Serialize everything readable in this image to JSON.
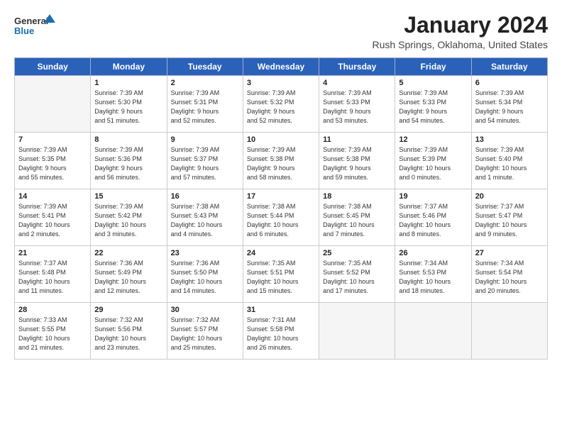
{
  "logo": {
    "line1": "General",
    "line2": "Blue"
  },
  "title": "January 2024",
  "location": "Rush Springs, Oklahoma, United States",
  "days_header": [
    "Sunday",
    "Monday",
    "Tuesday",
    "Wednesday",
    "Thursday",
    "Friday",
    "Saturday"
  ],
  "weeks": [
    [
      {
        "day": "",
        "info": ""
      },
      {
        "day": "1",
        "info": "Sunrise: 7:39 AM\nSunset: 5:30 PM\nDaylight: 9 hours\nand 51 minutes."
      },
      {
        "day": "2",
        "info": "Sunrise: 7:39 AM\nSunset: 5:31 PM\nDaylight: 9 hours\nand 52 minutes."
      },
      {
        "day": "3",
        "info": "Sunrise: 7:39 AM\nSunset: 5:32 PM\nDaylight: 9 hours\nand 52 minutes."
      },
      {
        "day": "4",
        "info": "Sunrise: 7:39 AM\nSunset: 5:33 PM\nDaylight: 9 hours\nand 53 minutes."
      },
      {
        "day": "5",
        "info": "Sunrise: 7:39 AM\nSunset: 5:33 PM\nDaylight: 9 hours\nand 54 minutes."
      },
      {
        "day": "6",
        "info": "Sunrise: 7:39 AM\nSunset: 5:34 PM\nDaylight: 9 hours\nand 54 minutes."
      }
    ],
    [
      {
        "day": "7",
        "info": "Sunrise: 7:39 AM\nSunset: 5:35 PM\nDaylight: 9 hours\nand 55 minutes."
      },
      {
        "day": "8",
        "info": "Sunrise: 7:39 AM\nSunset: 5:36 PM\nDaylight: 9 hours\nand 56 minutes."
      },
      {
        "day": "9",
        "info": "Sunrise: 7:39 AM\nSunset: 5:37 PM\nDaylight: 9 hours\nand 57 minutes."
      },
      {
        "day": "10",
        "info": "Sunrise: 7:39 AM\nSunset: 5:38 PM\nDaylight: 9 hours\nand 58 minutes."
      },
      {
        "day": "11",
        "info": "Sunrise: 7:39 AM\nSunset: 5:38 PM\nDaylight: 9 hours\nand 59 minutes."
      },
      {
        "day": "12",
        "info": "Sunrise: 7:39 AM\nSunset: 5:39 PM\nDaylight: 10 hours\nand 0 minutes."
      },
      {
        "day": "13",
        "info": "Sunrise: 7:39 AM\nSunset: 5:40 PM\nDaylight: 10 hours\nand 1 minute."
      }
    ],
    [
      {
        "day": "14",
        "info": "Sunrise: 7:39 AM\nSunset: 5:41 PM\nDaylight: 10 hours\nand 2 minutes."
      },
      {
        "day": "15",
        "info": "Sunrise: 7:39 AM\nSunset: 5:42 PM\nDaylight: 10 hours\nand 3 minutes."
      },
      {
        "day": "16",
        "info": "Sunrise: 7:38 AM\nSunset: 5:43 PM\nDaylight: 10 hours\nand 4 minutes."
      },
      {
        "day": "17",
        "info": "Sunrise: 7:38 AM\nSunset: 5:44 PM\nDaylight: 10 hours\nand 6 minutes."
      },
      {
        "day": "18",
        "info": "Sunrise: 7:38 AM\nSunset: 5:45 PM\nDaylight: 10 hours\nand 7 minutes."
      },
      {
        "day": "19",
        "info": "Sunrise: 7:37 AM\nSunset: 5:46 PM\nDaylight: 10 hours\nand 8 minutes."
      },
      {
        "day": "20",
        "info": "Sunrise: 7:37 AM\nSunset: 5:47 PM\nDaylight: 10 hours\nand 9 minutes."
      }
    ],
    [
      {
        "day": "21",
        "info": "Sunrise: 7:37 AM\nSunset: 5:48 PM\nDaylight: 10 hours\nand 11 minutes."
      },
      {
        "day": "22",
        "info": "Sunrise: 7:36 AM\nSunset: 5:49 PM\nDaylight: 10 hours\nand 12 minutes."
      },
      {
        "day": "23",
        "info": "Sunrise: 7:36 AM\nSunset: 5:50 PM\nDaylight: 10 hours\nand 14 minutes."
      },
      {
        "day": "24",
        "info": "Sunrise: 7:35 AM\nSunset: 5:51 PM\nDaylight: 10 hours\nand 15 minutes."
      },
      {
        "day": "25",
        "info": "Sunrise: 7:35 AM\nSunset: 5:52 PM\nDaylight: 10 hours\nand 17 minutes."
      },
      {
        "day": "26",
        "info": "Sunrise: 7:34 AM\nSunset: 5:53 PM\nDaylight: 10 hours\nand 18 minutes."
      },
      {
        "day": "27",
        "info": "Sunrise: 7:34 AM\nSunset: 5:54 PM\nDaylight: 10 hours\nand 20 minutes."
      }
    ],
    [
      {
        "day": "28",
        "info": "Sunrise: 7:33 AM\nSunset: 5:55 PM\nDaylight: 10 hours\nand 21 minutes."
      },
      {
        "day": "29",
        "info": "Sunrise: 7:32 AM\nSunset: 5:56 PM\nDaylight: 10 hours\nand 23 minutes."
      },
      {
        "day": "30",
        "info": "Sunrise: 7:32 AM\nSunset: 5:57 PM\nDaylight: 10 hours\nand 25 minutes."
      },
      {
        "day": "31",
        "info": "Sunrise: 7:31 AM\nSunset: 5:58 PM\nDaylight: 10 hours\nand 26 minutes."
      },
      {
        "day": "",
        "info": ""
      },
      {
        "day": "",
        "info": ""
      },
      {
        "day": "",
        "info": ""
      }
    ]
  ]
}
